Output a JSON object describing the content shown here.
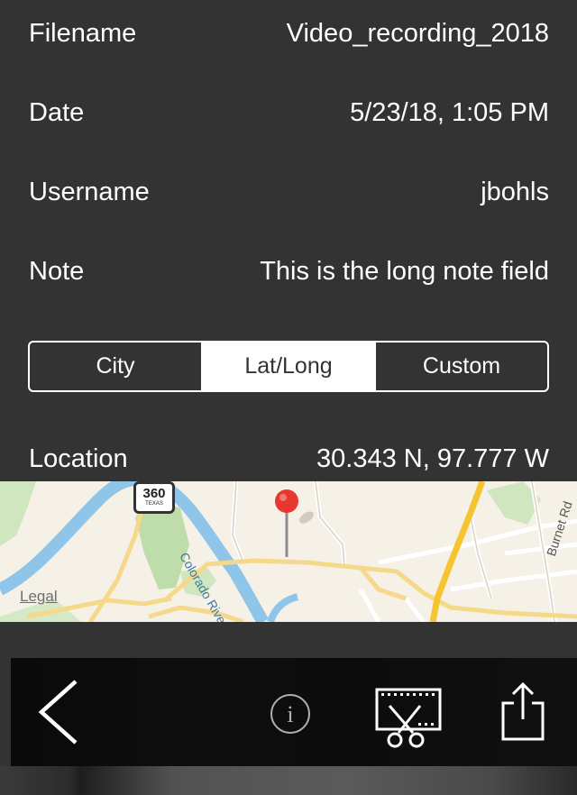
{
  "details": {
    "filename_label": "Filename",
    "filename_value": "Video_recording_2018",
    "date_label": "Date",
    "date_value": "5/23/18, 1:05 PM",
    "username_label": "Username",
    "username_value": "jbohls",
    "note_label": "Note",
    "note_value": "This is the long note field",
    "location_label": "Location",
    "location_value": "30.343 N, 97.777 W"
  },
  "location_format": {
    "options": [
      "City",
      "Lat/Long",
      "Custom"
    ],
    "selected": "Lat/Long"
  },
  "map": {
    "legal_label": "Legal",
    "highway_shield_number": "360",
    "highway_shield_state": "TEXAS",
    "river_label": "Colorado River",
    "street_label": "Burnet Rd",
    "pin_color": "#e8372e"
  },
  "toolbar": {
    "back_icon": "chevron-left-icon",
    "info_icon": "info-icon",
    "trim_icon": "film-scissors-icon",
    "share_icon": "share-icon"
  },
  "colors": {
    "background": "#333333",
    "toolbar": "#0d0d0d",
    "text": "#ffffff"
  }
}
